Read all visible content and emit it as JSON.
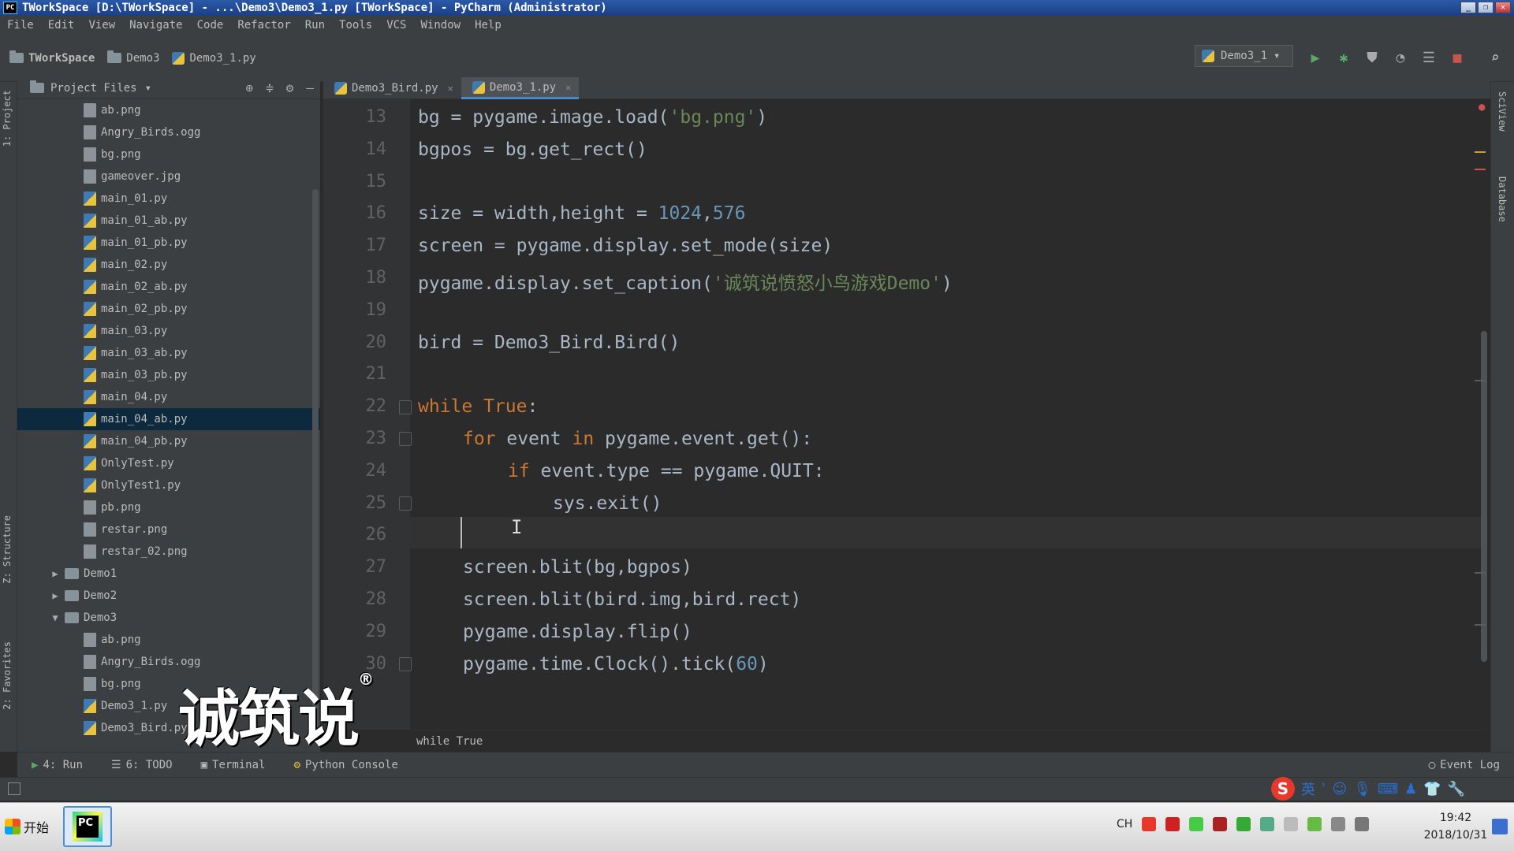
{
  "window": {
    "title": "TWorkSpace [D:\\TWorkSpace] - ...\\Demo3\\Demo3_1.py [TWorkSpace] - PyCharm (Administrator)",
    "app_badge": "PC"
  },
  "menu": [
    "File",
    "Edit",
    "View",
    "Navigate",
    "Code",
    "Refactor",
    "Run",
    "Tools",
    "VCS",
    "Window",
    "Help"
  ],
  "breadcrumbs": [
    "TWorkSpace",
    "Demo3",
    "Demo3_1.py"
  ],
  "run_config": "Demo3_1",
  "project_panel": {
    "title": "Project Files"
  },
  "tree": [
    {
      "label": "ab.png",
      "type": "file",
      "indent": 2
    },
    {
      "label": "Angry_Birds.ogg",
      "type": "file",
      "indent": 2
    },
    {
      "label": "bg.png",
      "type": "file",
      "indent": 2
    },
    {
      "label": "gameover.jpg",
      "type": "file",
      "indent": 2
    },
    {
      "label": "main_01.py",
      "type": "py",
      "indent": 2
    },
    {
      "label": "main_01_ab.py",
      "type": "py",
      "indent": 2
    },
    {
      "label": "main_01_pb.py",
      "type": "py",
      "indent": 2
    },
    {
      "label": "main_02.py",
      "type": "py",
      "indent": 2
    },
    {
      "label": "main_02_ab.py",
      "type": "py",
      "indent": 2
    },
    {
      "label": "main_02_pb.py",
      "type": "py",
      "indent": 2
    },
    {
      "label": "main_03.py",
      "type": "py",
      "indent": 2
    },
    {
      "label": "main_03_ab.py",
      "type": "py",
      "indent": 2
    },
    {
      "label": "main_03_pb.py",
      "type": "py",
      "indent": 2
    },
    {
      "label": "main_04.py",
      "type": "py",
      "indent": 2
    },
    {
      "label": "main_04_ab.py",
      "type": "py",
      "indent": 2,
      "selected": true
    },
    {
      "label": "main_04_pb.py",
      "type": "py",
      "indent": 2
    },
    {
      "label": "OnlyTest.py",
      "type": "py",
      "indent": 2
    },
    {
      "label": "OnlyTest1.py",
      "type": "py",
      "indent": 2
    },
    {
      "label": "pb.png",
      "type": "file",
      "indent": 2
    },
    {
      "label": "restar.png",
      "type": "file",
      "indent": 2
    },
    {
      "label": "restar_02.png",
      "type": "file",
      "indent": 2
    },
    {
      "label": "Demo1",
      "type": "dir",
      "indent": 1,
      "arrow": "▶"
    },
    {
      "label": "Demo2",
      "type": "dir",
      "indent": 1,
      "arrow": "▶"
    },
    {
      "label": "Demo3",
      "type": "dir",
      "indent": 1,
      "arrow": "▼"
    },
    {
      "label": "ab.png",
      "type": "file",
      "indent": 2
    },
    {
      "label": "Angry_Birds.ogg",
      "type": "file",
      "indent": 2
    },
    {
      "label": "bg.png",
      "type": "file",
      "indent": 2
    },
    {
      "label": "Demo3_1.py",
      "type": "py",
      "indent": 2
    },
    {
      "label": "Demo3_Bird.py",
      "type": "py",
      "indent": 2
    }
  ],
  "tabs": [
    {
      "label": "Demo3_Bird.py",
      "active": false
    },
    {
      "label": "Demo3_1.py",
      "active": true
    }
  ],
  "code": [
    {
      "n": "13",
      "indent": 0,
      "html": "bg = pygame.image.load(<span class=\"str\">'bg.png'</span>)"
    },
    {
      "n": "14",
      "indent": 0,
      "html": "bgpos = bg.get_rect()"
    },
    {
      "n": "15",
      "indent": 0,
      "html": ""
    },
    {
      "n": "16",
      "indent": 0,
      "html": "size = width,height = <span class=\"num\">1024</span>,<span class=\"num\">576</span>"
    },
    {
      "n": "17",
      "indent": 0,
      "html": "screen = pygame.display.set_mode(size)"
    },
    {
      "n": "18",
      "indent": 0,
      "html": "pygame.display.set_caption(<span class=\"str\">'诚筑说愤怒小鸟游戏Demo'</span>)"
    },
    {
      "n": "19",
      "indent": 0,
      "html": ""
    },
    {
      "n": "20",
      "indent": 0,
      "html": "bird = Demo3_Bird.Bird()"
    },
    {
      "n": "21",
      "indent": 0,
      "html": ""
    },
    {
      "n": "22",
      "indent": 0,
      "html": "<span class=\"kw\">while True</span>:"
    },
    {
      "n": "23",
      "indent": 1,
      "html": "<span class=\"kw\">for</span> event <span class=\"kw\">in</span> pygame.event.get():"
    },
    {
      "n": "24",
      "indent": 2,
      "html": "<span class=\"kw\">if</span> event.type == pygame.QUIT:"
    },
    {
      "n": "25",
      "indent": 3,
      "html": "sys.exit()"
    },
    {
      "n": "26",
      "indent": 0,
      "html": ""
    },
    {
      "n": "27",
      "indent": 1,
      "html": "screen.blit(bg,bgpos)"
    },
    {
      "n": "28",
      "indent": 1,
      "html": "screen.blit(bird.img,bird.rect)"
    },
    {
      "n": "29",
      "indent": 1,
      "html": "pygame.display.flip()"
    },
    {
      "n": "30",
      "indent": 1,
      "html": "pygame.time.Clock().tick(<span class=\"num\">60</span>)"
    }
  ],
  "editor_breadcrumb": "while True",
  "bottom_tabs": [
    "4: Run",
    "6: TODO",
    "Terminal",
    "Python Console"
  ],
  "event_log": "Event Log",
  "side_tabs": {
    "project": "1: Project",
    "structure": "Z: Structure",
    "favorites": "2: Favorites",
    "sciview": "SciView",
    "database": "Database"
  },
  "ime": {
    "logo": "S",
    "mode": "英"
  },
  "taskbar": {
    "start": "开始",
    "lang": "CH",
    "time": "19:42",
    "date": "2018/10/31"
  },
  "watermark": "诚筑说"
}
